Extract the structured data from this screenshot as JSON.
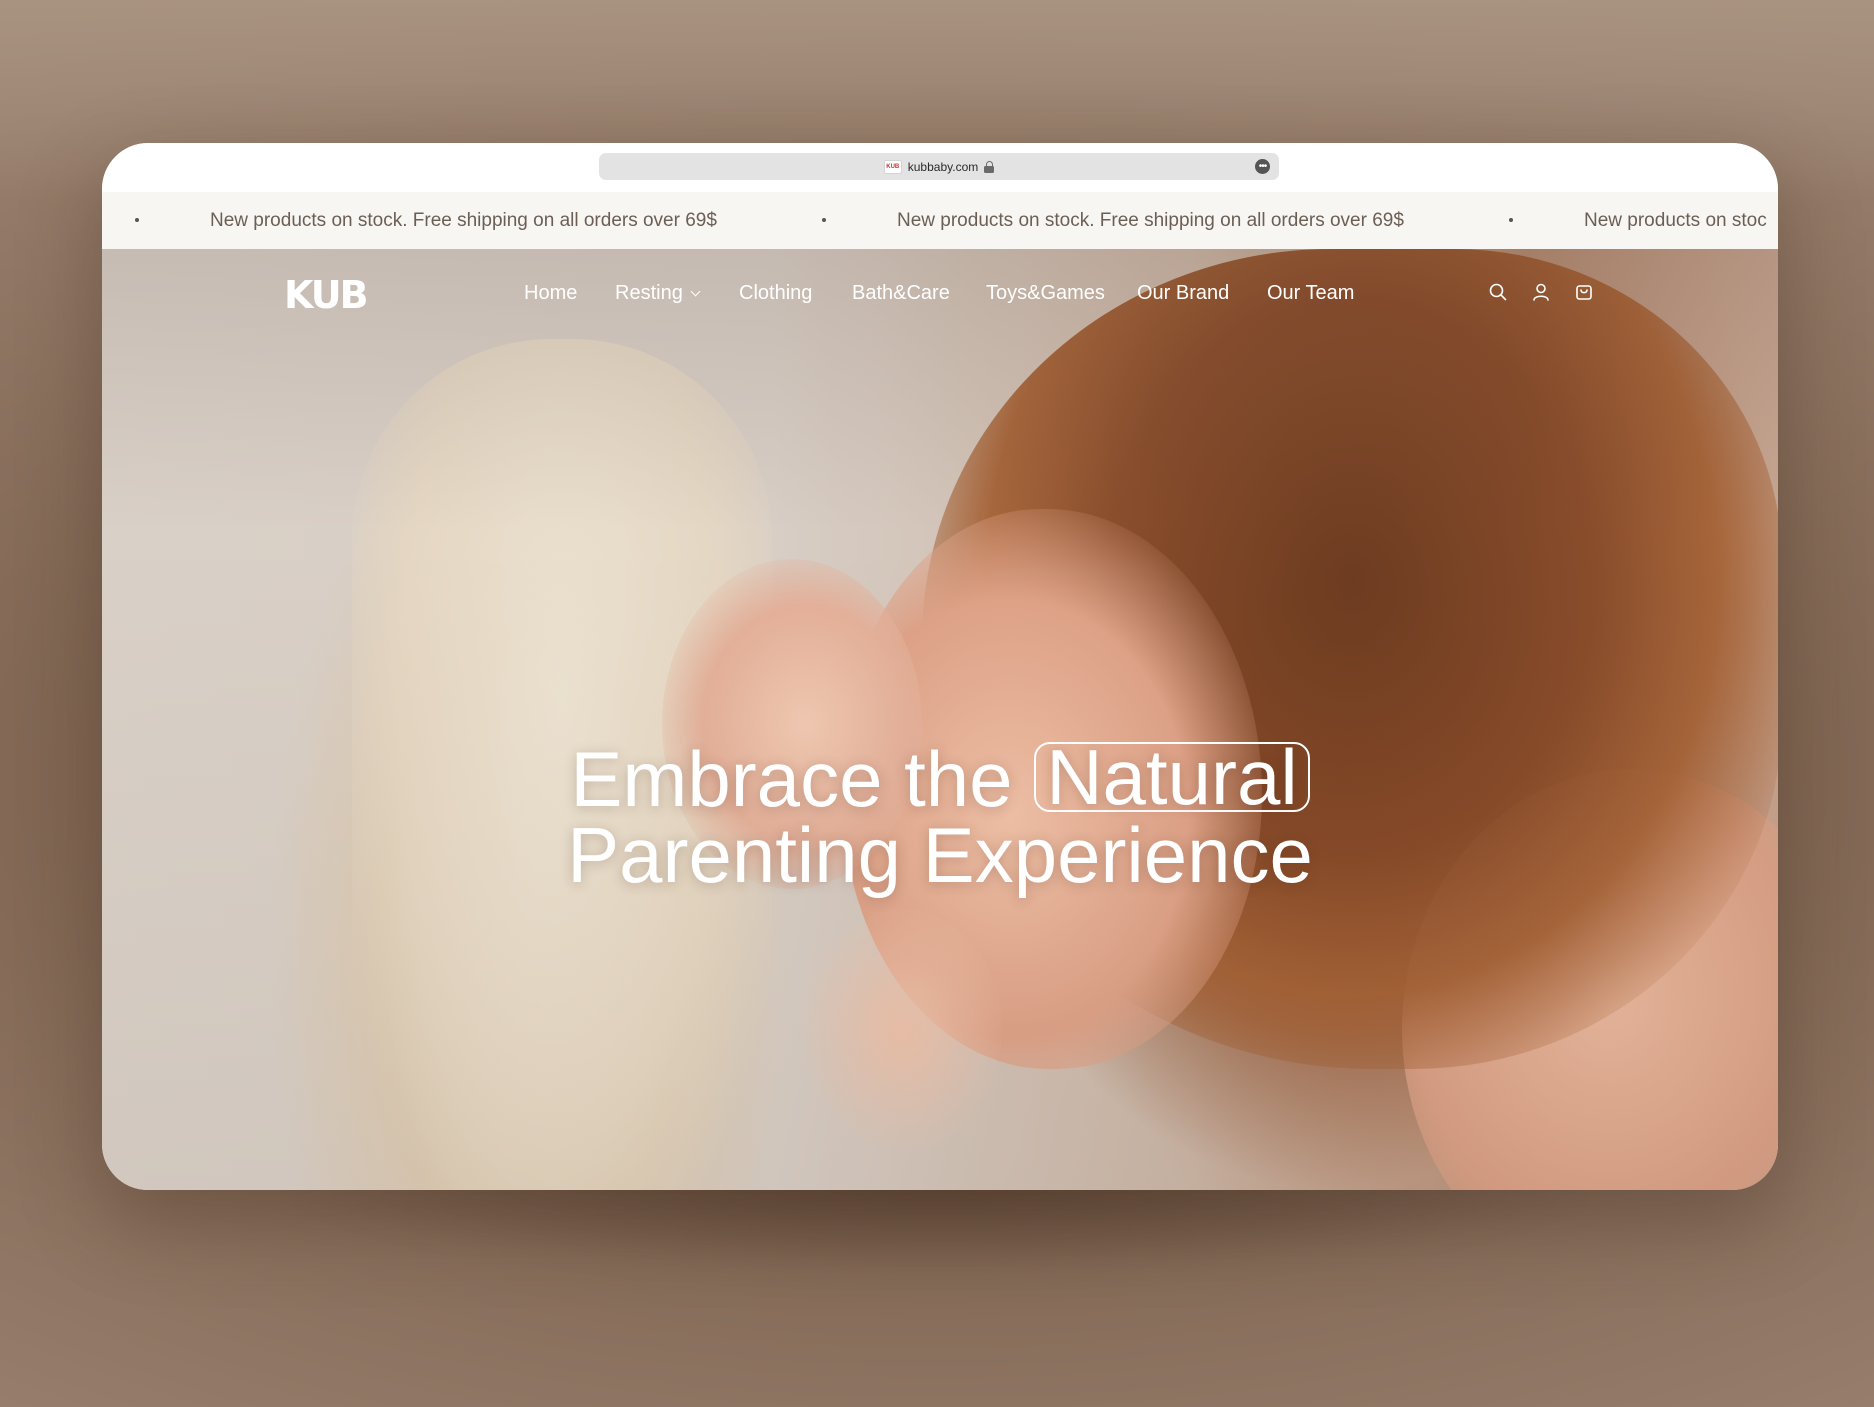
{
  "browser": {
    "url": "kubbaby.com",
    "favicon_text": "KUB"
  },
  "announcement": {
    "text": "New products on stock. Free shipping on all orders over 69$",
    "text_cut": "New products on stoc"
  },
  "nav": {
    "logo": "KUB",
    "links": [
      {
        "label": "Home"
      },
      {
        "label": "Resting",
        "has_dropdown": true
      },
      {
        "label": "Clothing"
      },
      {
        "label": "Bath&Care"
      },
      {
        "label": "Toys&Games"
      },
      {
        "label": "Our Brand"
      },
      {
        "label": "Our Team"
      }
    ],
    "icons": [
      "search-icon",
      "account-icon",
      "cart-icon"
    ]
  },
  "hero": {
    "headline_part1": "Embrace the",
    "headline_highlight": "Natural",
    "headline_line2": "Parenting Experience"
  },
  "colors": {
    "backdrop": "#8a7160",
    "announcement_bg": "#f8f6f3",
    "announcement_text": "#6b5f55",
    "nav_text": "#ffffff"
  }
}
